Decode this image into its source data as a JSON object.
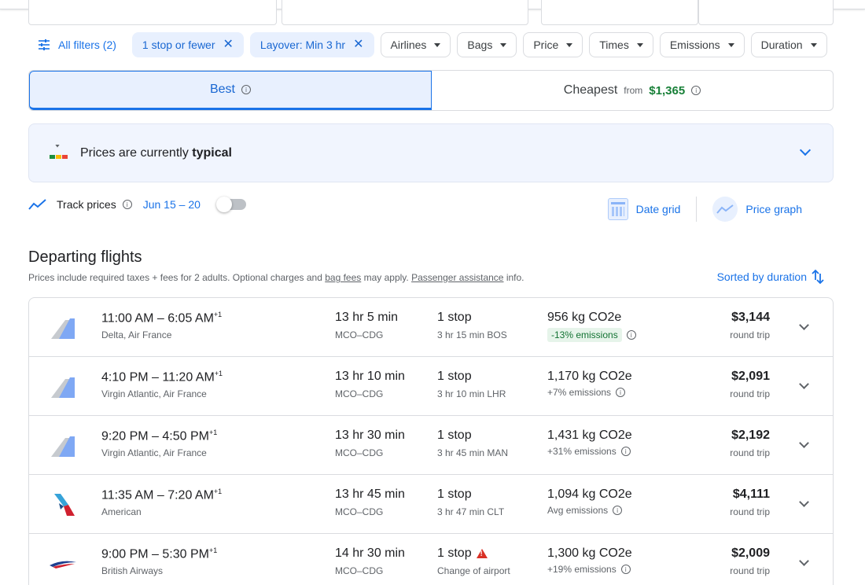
{
  "filters": {
    "all_filters": "All filters (2)",
    "chips": [
      {
        "label": "1 stop or fewer",
        "active": true
      },
      {
        "label": "Layover: Min 3 hr",
        "active": true
      },
      {
        "label": "Airlines"
      },
      {
        "label": "Bags"
      },
      {
        "label": "Price"
      },
      {
        "label": "Times"
      },
      {
        "label": "Emissions"
      },
      {
        "label": "Duration"
      }
    ]
  },
  "tabs": {
    "best": "Best",
    "cheapest": "Cheapest",
    "from": "from",
    "cheapest_price": "$1,365"
  },
  "insight": {
    "prefix": "Prices are currently ",
    "level": "typical"
  },
  "tracking": {
    "label": "Track prices",
    "dates": "Jun 15 – 20",
    "enabled": false
  },
  "tools": {
    "date_grid": "Date grid",
    "price_graph": "Price graph"
  },
  "departing": {
    "title": "Departing flights",
    "note_prefix": "Prices include required taxes + fees for 2 adults. Optional charges and ",
    "bag_fees": "bag fees",
    "note_middle": " may apply. ",
    "assistance": "Passenger assistance",
    "note_suffix": " info.",
    "sorted": "Sorted by duration"
  },
  "flights": [
    {
      "times": "11:00 AM – 6:05 AM",
      "plus": "+1",
      "airline": "Delta, Air France",
      "duration": "13 hr 5 min",
      "route": "MCO–CDG",
      "stops": "1 stop",
      "layover": "3 hr 15 min BOS",
      "co2": "956 kg CO2e",
      "emissions": "-13% emissions",
      "price": "$3,144",
      "trip": "round trip",
      "logo": "airfrance-tail"
    },
    {
      "times": "4:10 PM – 11:20 AM",
      "plus": "+1",
      "airline": "Virgin Atlantic, Air France",
      "duration": "13 hr 10 min",
      "route": "MCO–CDG",
      "stops": "1 stop",
      "layover": "3 hr 10 min LHR",
      "co2": "1,170 kg CO2e",
      "emissions": "+7% emissions",
      "price": "$2,091",
      "trip": "round trip",
      "logo": "airfrance-tail"
    },
    {
      "times": "9:20 PM – 4:50 PM",
      "plus": "+1",
      "airline": "Virgin Atlantic, Air France",
      "duration": "13 hr 30 min",
      "route": "MCO–CDG",
      "stops": "1 stop",
      "layover": "3 hr 45 min MAN",
      "co2": "1,431 kg CO2e",
      "emissions": "+31% emissions",
      "price": "$2,192",
      "trip": "round trip",
      "logo": "airfrance-tail"
    },
    {
      "times": "11:35 AM – 7:20 AM",
      "plus": "+1",
      "airline": "American",
      "duration": "13 hr 45 min",
      "route": "MCO–CDG",
      "stops": "1 stop",
      "layover": "3 hr 47 min CLT",
      "co2": "1,094 kg CO2e",
      "emissions": "Avg emissions",
      "price": "$4,111",
      "trip": "round trip",
      "logo": "american-tail"
    },
    {
      "times": "9:00 PM – 5:30 PM",
      "plus": "+1",
      "airline": "British Airways",
      "duration": "14 hr 30 min",
      "route": "MCO–CDG",
      "stops": "1 stop",
      "layover": "Change of airport",
      "co2": "1,300 kg CO2e",
      "emissions": "+19% emissions",
      "price": "$2,009",
      "trip": "round trip",
      "logo": "british-airways-ribbon"
    }
  ],
  "colors": {
    "accent": "#1a73e8",
    "price_green": "#188038",
    "emission_good_bg": "#e6f4ea",
    "warning": "#d93025"
  }
}
